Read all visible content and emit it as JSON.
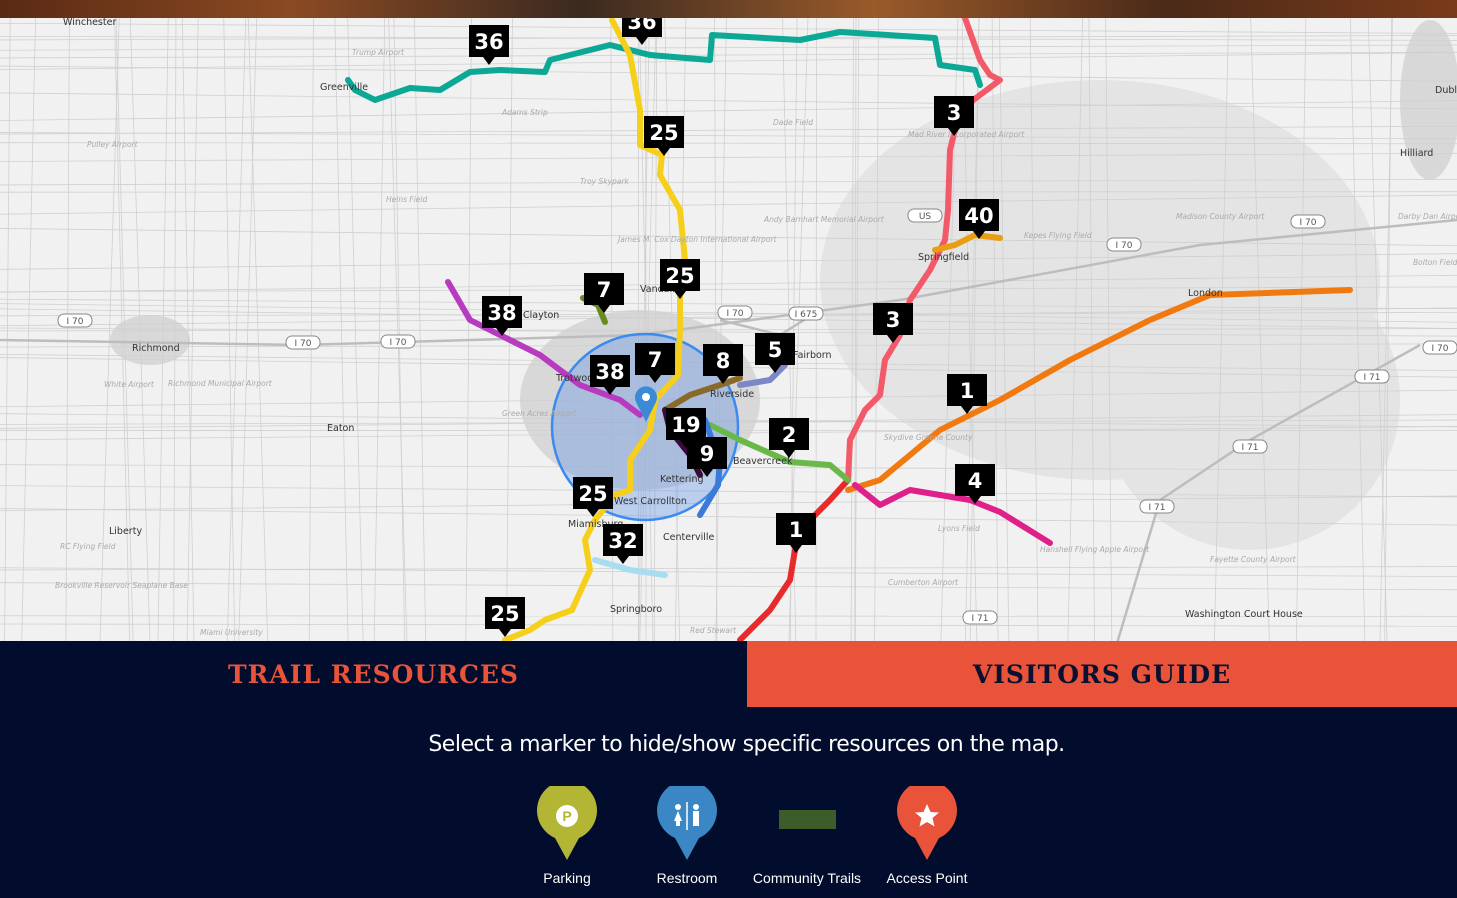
{
  "map": {
    "markers": [
      "36",
      "36",
      "25",
      "25",
      "7",
      "38",
      "7",
      "8",
      "5",
      "38",
      "19",
      "9",
      "2",
      "25",
      "32",
      "25",
      "3",
      "40",
      "3",
      "1",
      "4",
      "1"
    ],
    "towns": [
      "Winchester",
      "Greenville",
      "Richmond",
      "Eaton",
      "Liberty",
      "Clayton",
      "Vandalia",
      "Springfield",
      "Hilliard",
      "Centerville",
      "Springboro",
      "Kettering",
      "Beavercreek",
      "Washington Court House",
      "Dublin",
      "Trotwood",
      "Miamisburg",
      "West Carrollton",
      "Fairborn",
      "Riverside",
      "London"
    ],
    "airports": [
      "Trump Airport",
      "Adams Strip",
      "Pulley Airport",
      "Troy Skypark",
      "Heins Field",
      "James M. Cox Dayton International Airport",
      "Dade Field",
      "Andy Barnhart Memorial Airport",
      "Mad River Incorporated Airport",
      "Madison County Airport",
      "Darby Dan Airport",
      "Bolton Field",
      "Kepes Flying Field",
      "White Airport",
      "Richmond Municipal Airport",
      "Green Acres Airport",
      "Skydive Greene County",
      "Lyons Field",
      "Hanshell Flying Apple Airport",
      "Cumberton Airport",
      "Fayette County Airport",
      "Brookville Reservoir Seaplane Base",
      "RC Flying Field",
      "Miami University",
      "Red Stewart"
    ],
    "highways": [
      "I 70",
      "I 70",
      "I 70",
      "I 70",
      "I 70",
      "I 675",
      "I 70",
      "I 70",
      "I 71",
      "I 71",
      "I 71",
      "I 71",
      "US"
    ],
    "trail_colors": {
      "36": "#0aa895",
      "25": "#f5cf1a",
      "3": "#f25a6a",
      "40": "#e89e10",
      "1r": "#ea2a2a",
      "1o": "#f07a10",
      "4": "#e0208a",
      "2": "#6ab84a",
      "38": "#b83ac0",
      "7": "#6a8a20",
      "8": "#8a6a2a",
      "5": "#7a88c8",
      "19": "#3a0a3a",
      "9": "#3a7ad8",
      "32": "#a8dcf0"
    }
  },
  "tabs": {
    "trail_resources": "TRAIL RESOURCES",
    "visitors_guide": "VISITORS GUIDE"
  },
  "instructions": "Select a marker to hide/show specific resources on the map.",
  "legend": [
    {
      "label": "Parking",
      "icon": "parking-pin-icon",
      "color": "#b3b534"
    },
    {
      "label": "Restroom",
      "icon": "restroom-pin-icon",
      "color": "#3b86c4"
    },
    {
      "label": "Community Trails",
      "icon": "trail-line-icon",
      "color": "#3c5d2a"
    },
    {
      "label": "Access Point",
      "icon": "access-point-pin-icon",
      "color": "#e8533a"
    }
  ]
}
